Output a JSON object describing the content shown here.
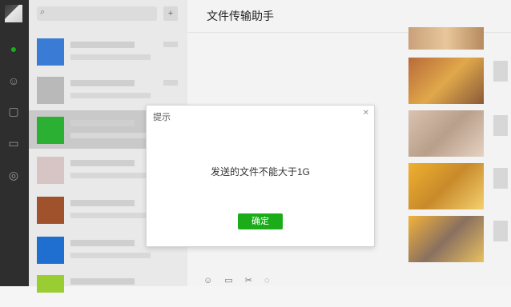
{
  "chat": {
    "title": "文件传输助手"
  },
  "dialog": {
    "title": "提示",
    "message": "发送的文件不能大于1G",
    "ok_label": "确定"
  },
  "colors": {
    "accent": "#1aad19",
    "rail": "#2e2e2e"
  },
  "icons": [
    "chat-icon",
    "contacts-icon",
    "favorites-icon",
    "folder-icon",
    "moments-icon",
    "search-icon",
    "plus-icon",
    "emoji-icon",
    "file-icon",
    "scissors-icon",
    "chat-history-icon"
  ]
}
